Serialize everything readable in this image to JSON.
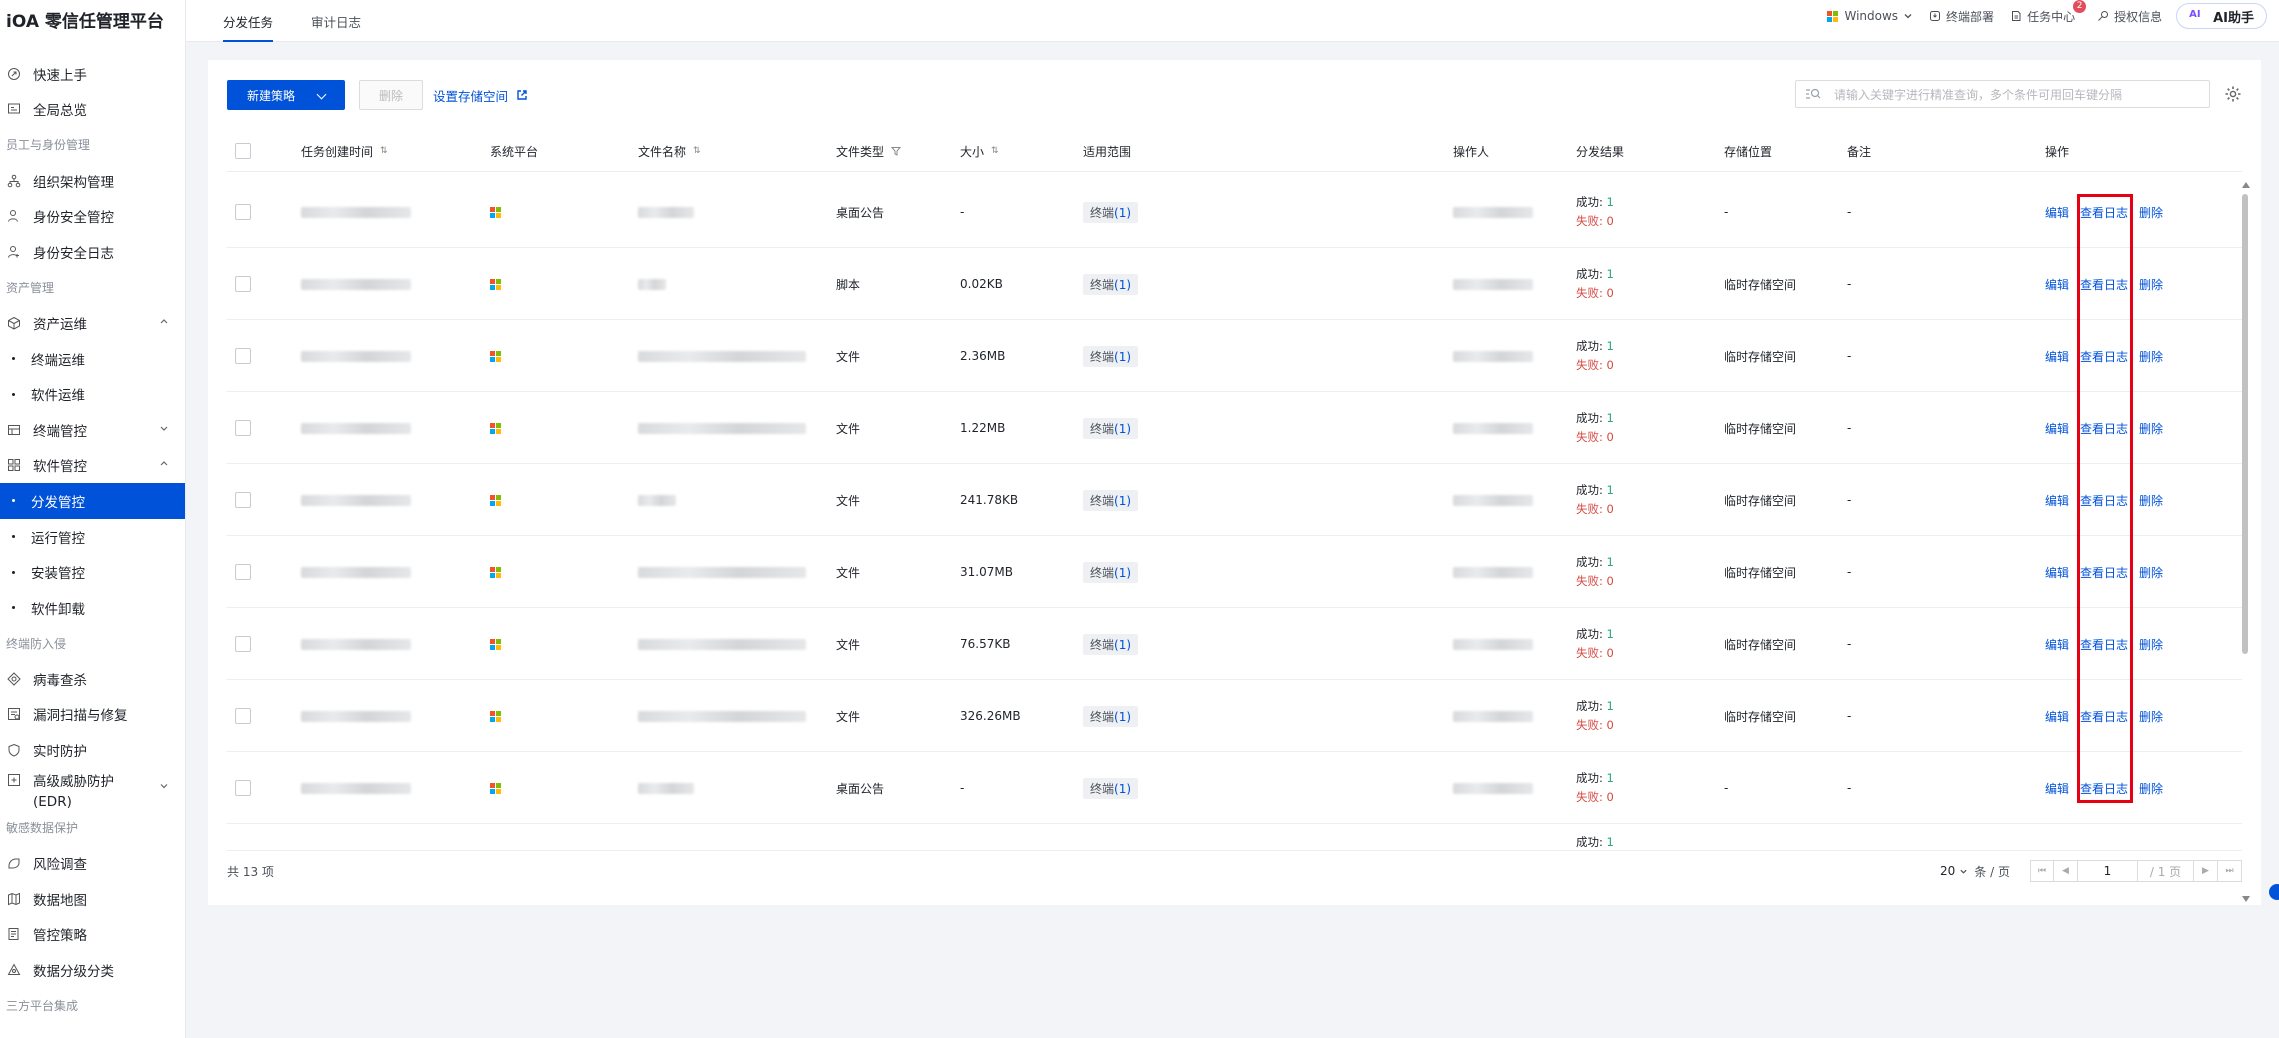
{
  "app": {
    "title": "iOA 零信任管理平台"
  },
  "sidebar": {
    "items": [
      {
        "type": "item",
        "label": "快速上手",
        "icon": "rocket-icon"
      },
      {
        "type": "item",
        "label": "全局总览",
        "icon": "dashboard-icon"
      },
      {
        "type": "group",
        "label": "员工与身份管理"
      },
      {
        "type": "item",
        "label": "组织架构管理",
        "icon": "org-icon"
      },
      {
        "type": "item",
        "label": "身份安全管控",
        "icon": "user-shield-icon"
      },
      {
        "type": "item",
        "label": "身份安全日志",
        "icon": "user-log-icon"
      },
      {
        "type": "group",
        "label": "资产管理"
      },
      {
        "type": "item",
        "label": "资产运维",
        "icon": "cube-icon",
        "chevron": "up"
      },
      {
        "type": "sub",
        "label": "终端运维"
      },
      {
        "type": "sub",
        "label": "软件运维"
      },
      {
        "type": "item",
        "label": "终端管控",
        "icon": "terminal-icon",
        "chevron": "down"
      },
      {
        "type": "item",
        "label": "软件管控",
        "icon": "apps-icon",
        "chevron": "up"
      },
      {
        "type": "sub",
        "label": "分发管控",
        "active": true
      },
      {
        "type": "sub",
        "label": "运行管控"
      },
      {
        "type": "sub",
        "label": "安装管控"
      },
      {
        "type": "sub",
        "label": "软件卸载"
      },
      {
        "type": "group",
        "label": "终端防入侵"
      },
      {
        "type": "item",
        "label": "病毒查杀",
        "icon": "virus-icon"
      },
      {
        "type": "item",
        "label": "漏洞扫描与修复",
        "icon": "scan-icon"
      },
      {
        "type": "item",
        "label": "实时防护",
        "icon": "shield-icon"
      },
      {
        "type": "item",
        "label": "高级威胁防护\n(EDR)",
        "icon": "threat-icon",
        "chevron": "down",
        "tall": true
      },
      {
        "type": "group",
        "label": "敏感数据保护"
      },
      {
        "type": "item",
        "label": "风险调查",
        "icon": "risk-icon"
      },
      {
        "type": "item",
        "label": "数据地图",
        "icon": "map-icon"
      },
      {
        "type": "item",
        "label": "管控策略",
        "icon": "policy-icon"
      },
      {
        "type": "item",
        "label": "数据分级分类",
        "icon": "classify-icon"
      },
      {
        "type": "group",
        "label": "三方平台集成"
      }
    ]
  },
  "header": {
    "tabs": [
      {
        "label": "分发任务",
        "active": true
      },
      {
        "label": "审计日志",
        "active": false
      }
    ],
    "platform": "Windows",
    "deploy": "终端部署",
    "task_center": "任务中心",
    "task_badge": "2",
    "license": "授权信息",
    "ai": "AI助手"
  },
  "toolbar": {
    "new_policy": "新建策略",
    "delete": "删除",
    "storage_link": "设置存储空间",
    "search_placeholder": "请输入关键字进行精准查询，多个条件可用回车键分隔"
  },
  "table": {
    "columns": {
      "created": "任务创建时间",
      "platform": "系统平台",
      "filename": "文件名称",
      "filetype": "文件类型",
      "size": "大小",
      "scope": "适用范围",
      "operator": "操作人",
      "result": "分发结果",
      "storage": "存储位置",
      "note": "备注",
      "ops": "操作"
    },
    "rows": [
      {
        "type": "桌面公告",
        "size": "-",
        "scope": "终端(1)",
        "ok_label": "成功:",
        "ok": "1",
        "fail_label": "失败:",
        "fail": "0",
        "storage": "-",
        "note": "-",
        "name_w": 56
      },
      {
        "type": "脚本",
        "size": "0.02KB",
        "scope": "终端(1)",
        "ok_label": "成功:",
        "ok": "1",
        "fail_label": "失败:",
        "fail": "0",
        "storage": "临时存储空间",
        "note": "-",
        "name_w": 28
      },
      {
        "type": "文件",
        "size": "2.36MB",
        "scope": "终端(1)",
        "ok_label": "成功:",
        "ok": "1",
        "fail_label": "失败:",
        "fail": "0",
        "storage": "临时存储空间",
        "note": "-",
        "name_w": 168
      },
      {
        "type": "文件",
        "size": "1.22MB",
        "scope": "终端(1)",
        "ok_label": "成功:",
        "ok": "1",
        "fail_label": "失败:",
        "fail": "0",
        "storage": "临时存储空间",
        "note": "-",
        "name_w": 168
      },
      {
        "type": "文件",
        "size": "241.78KB",
        "scope": "终端(1)",
        "ok_label": "成功:",
        "ok": "1",
        "fail_label": "失败:",
        "fail": "0",
        "storage": "临时存储空间",
        "note": "-",
        "name_w": 38
      },
      {
        "type": "文件",
        "size": "31.07MB",
        "scope": "终端(1)",
        "ok_label": "成功:",
        "ok": "1",
        "fail_label": "失败:",
        "fail": "0",
        "storage": "临时存储空间",
        "note": "-",
        "name_w": 168
      },
      {
        "type": "文件",
        "size": "76.57KB",
        "scope": "终端(1)",
        "ok_label": "成功:",
        "ok": "1",
        "fail_label": "失败:",
        "fail": "0",
        "storage": "临时存储空间",
        "note": "-",
        "name_w": 168
      },
      {
        "type": "文件",
        "size": "326.26MB",
        "scope": "终端(1)",
        "ok_label": "成功:",
        "ok": "1",
        "fail_label": "失败:",
        "fail": "0",
        "storage": "临时存储空间",
        "note": "-",
        "name_w": 168
      },
      {
        "type": "桌面公告",
        "size": "-",
        "scope": "终端(1)",
        "ok_label": "成功:",
        "ok": "1",
        "fail_label": "失败:",
        "fail": "0",
        "storage": "-",
        "note": "-",
        "name_w": 56
      },
      {
        "type": "",
        "size": "",
        "scope": "",
        "ok_label": "成功:",
        "ok": "1",
        "fail_label": "",
        "fail": "",
        "storage": "",
        "note": "",
        "name_w": 0,
        "partial": true
      }
    ],
    "ops": {
      "edit": "编辑",
      "view_log": "查看日志",
      "delete": "删除"
    }
  },
  "footer": {
    "total": "共 13 项",
    "page_size": "20",
    "page_size_unit": "条 / 页",
    "current_page": "1",
    "total_pages": "/ 1 页"
  },
  "colors": {
    "primary": "#0052d9",
    "success": "#2ba471",
    "danger": "#d54941",
    "highlight": "#e60012"
  }
}
